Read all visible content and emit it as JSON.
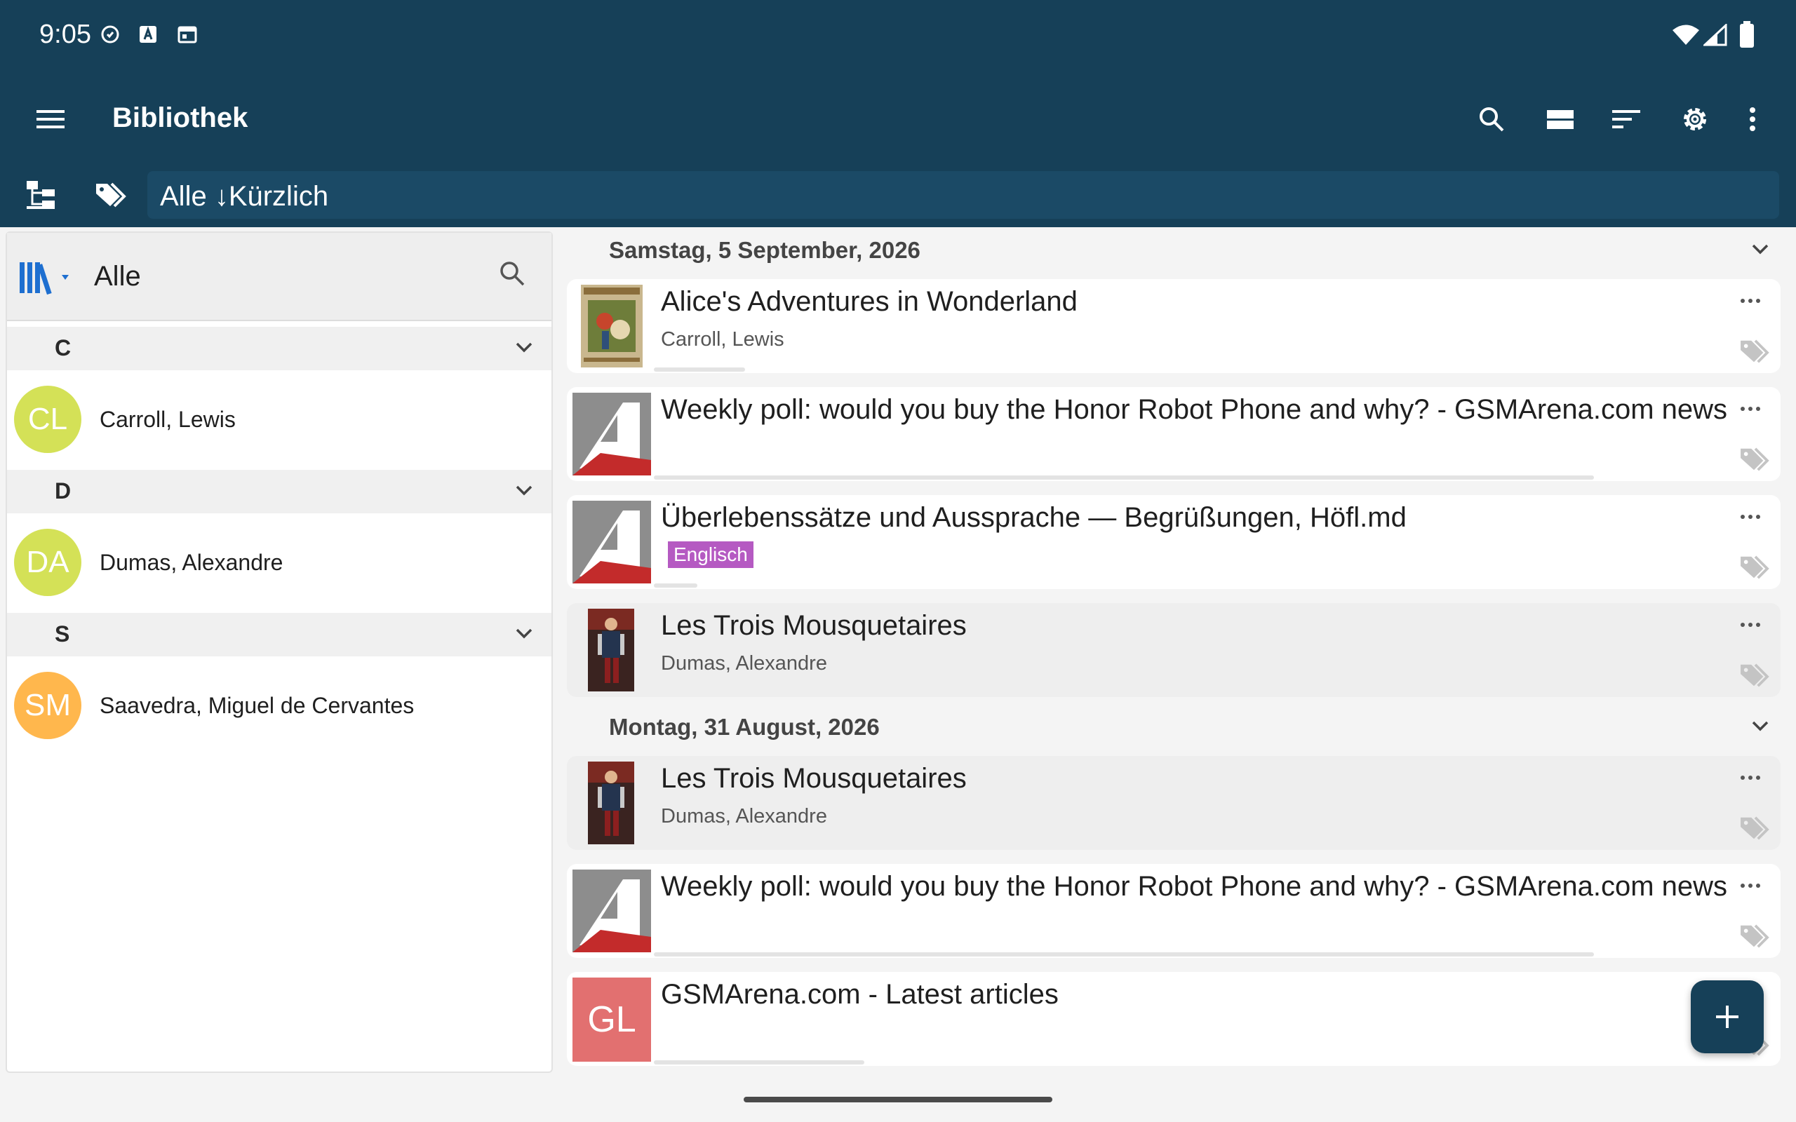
{
  "status_bar": {
    "time": "9:05"
  },
  "app_bar": {
    "title": "Bibliothek"
  },
  "filter_bar": {
    "text": "Alle ↓Kürzlich"
  },
  "colors": {
    "primary": "#164058",
    "avatar_green": "#d4e157",
    "avatar_orange": "#ffb74d",
    "tag_purple": "#b55ac2",
    "gl_thumb": "#e27070"
  },
  "left_panel": {
    "search_value": "Alle",
    "groups": [
      {
        "letter": "C",
        "authors": [
          {
            "initials": "CL",
            "name": "Carroll, Lewis"
          }
        ]
      },
      {
        "letter": "D",
        "authors": [
          {
            "initials": "DA",
            "name": "Dumas, Alexandre"
          }
        ]
      },
      {
        "letter": "S",
        "authors": [
          {
            "initials": "SM",
            "name": "Saavedra, Miguel de Cervantes"
          }
        ]
      }
    ]
  },
  "list": {
    "sections": [
      {
        "date": "Samstag, 5 September, 2026",
        "items": [
          {
            "title": "Alice's Adventures in Wonderland",
            "subtitle": "Carroll, Lewis",
            "thumb": "alice-cover"
          },
          {
            "title": "Weekly poll: would you buy the Honor Robot Phone and why? - GSMArena.com news",
            "subtitle": "",
            "thumb": "gsmarena-logo"
          },
          {
            "title": "Überlebenssätze und Aussprache — Begrüßungen, Höfl.md",
            "tag": "Englisch",
            "thumb": "gsmarena-logo"
          },
          {
            "title": "Les Trois Mousquetaires",
            "subtitle": "Dumas, Alexandre",
            "thumb": "musketeer-cover"
          }
        ]
      },
      {
        "date": "Montag, 31 August, 2026",
        "items": [
          {
            "title": "Les Trois Mousquetaires",
            "subtitle": "Dumas, Alexandre",
            "thumb": "musketeer-cover"
          },
          {
            "title": "Weekly poll: would you buy the Honor Robot Phone and why? - GSMArena.com news",
            "subtitle": "",
            "thumb": "gsmarena-logo"
          },
          {
            "title": "GSMArena.com - Latest articles",
            "initials": "GL",
            "thumb": "initials-tile"
          }
        ]
      }
    ]
  }
}
